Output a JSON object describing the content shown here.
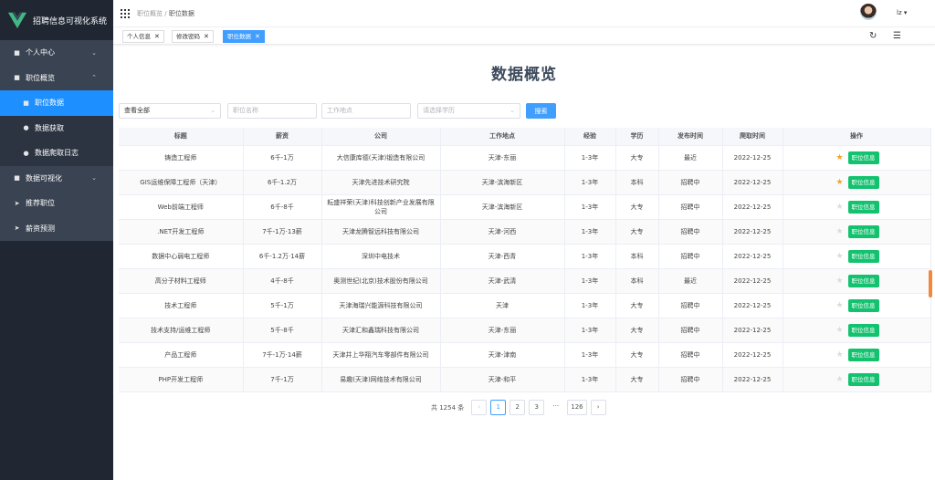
{
  "app": {
    "title": "招聘信息可视化系统"
  },
  "sidebar": {
    "items": [
      {
        "label": "个人中心",
        "icon": "square-icon"
      },
      {
        "label": "职位概览",
        "icon": "square-icon"
      },
      {
        "label": "职位数据",
        "icon": "square-icon"
      },
      {
        "label": "数据获取",
        "icon": "user-icon"
      },
      {
        "label": "数据爬取日志",
        "icon": "user-icon"
      },
      {
        "label": "数据可视化",
        "icon": "square-icon"
      },
      {
        "label": "推荐职位",
        "icon": "send-icon"
      },
      {
        "label": "薪资预测",
        "icon": "send-icon"
      }
    ]
  },
  "header": {
    "breadcrumb": [
      "职位概览",
      "职位数据"
    ],
    "user": "lz"
  },
  "tags": [
    "个人信息",
    "修改密码",
    "职位数据"
  ],
  "main": {
    "title": "数据概览",
    "filters": {
      "type": "查看全部",
      "name_placeholder": "职位名称",
      "location_placeholder": "工作地点",
      "education_placeholder": "请选择学历",
      "search_label": "搜索"
    },
    "columns": [
      "标题",
      "薪资",
      "公司",
      "工作地点",
      "经验",
      "学历",
      "发布时间",
      "爬取时间",
      "操作"
    ],
    "action_label": "职位信息",
    "rows": [
      {
        "title": "铸造工程师",
        "salary": "6千-1万",
        "company": "大信康库德(天津)锻造有限公司",
        "location": "天津-东丽",
        "exp": "1-3年",
        "edu": "大专",
        "posted": "最近",
        "crawled": "2022-12-25",
        "starred": true
      },
      {
        "title": "GIS运维保障工程师（天津）",
        "salary": "6千-1.2万",
        "company": "天津先进技术研究院",
        "location": "天津-滨海新区",
        "exp": "1-3年",
        "edu": "本科",
        "posted": "招聘中",
        "crawled": "2022-12-25",
        "starred": true
      },
      {
        "title": "Web前端工程师",
        "salary": "6千-8千",
        "company": "耘盛祥荣(天津)科技创新产业发展有限公司",
        "location": "天津-滨海新区",
        "exp": "1-3年",
        "edu": "大专",
        "posted": "招聘中",
        "crawled": "2022-12-25",
        "starred": false
      },
      {
        "title": ".NET开发工程师",
        "salary": "7千-1万·13薪",
        "company": "天津龙腾智远科技有限公司",
        "location": "天津-河西",
        "exp": "1-3年",
        "edu": "大专",
        "posted": "招聘中",
        "crawled": "2022-12-25",
        "starred": false
      },
      {
        "title": "数据中心弱电工程师",
        "salary": "6千-1.2万·14薪",
        "company": "深圳中电技术",
        "location": "天津-西青",
        "exp": "1-3年",
        "edu": "本科",
        "posted": "招聘中",
        "crawled": "2022-12-25",
        "starred": false
      },
      {
        "title": "高分子材料工程师",
        "salary": "4千-8千",
        "company": "奥测世纪(北京)技术股份有限公司",
        "location": "天津-武清",
        "exp": "1-3年",
        "edu": "本科",
        "posted": "最近",
        "crawled": "2022-12-25",
        "starred": false
      },
      {
        "title": "技术工程师",
        "salary": "5千-1万",
        "company": "天津海瑞兴能源科技有限公司",
        "location": "天津",
        "exp": "1-3年",
        "edu": "大专",
        "posted": "招聘中",
        "crawled": "2022-12-25",
        "starred": false
      },
      {
        "title": "技术支持/运维工程师",
        "salary": "5千-8千",
        "company": "天津汇和鑫瑞科技有限公司",
        "location": "天津-东丽",
        "exp": "1-3年",
        "edu": "大专",
        "posted": "招聘中",
        "crawled": "2022-12-25",
        "starred": false
      },
      {
        "title": "产品工程师",
        "salary": "7千-1万·14薪",
        "company": "天津井上华翔汽车零部件有限公司",
        "location": "天津-津南",
        "exp": "1-3年",
        "edu": "大专",
        "posted": "招聘中",
        "crawled": "2022-12-25",
        "starred": false
      },
      {
        "title": "PHP开发工程师",
        "salary": "7千-1万",
        "company": "易趣(天津)网络技术有限公司",
        "location": "天津-和平",
        "exp": "1-3年",
        "edu": "大专",
        "posted": "招聘中",
        "crawled": "2022-12-25",
        "starred": false
      }
    ],
    "pagination": {
      "total": "共 1254 条",
      "pages": [
        "1",
        "2",
        "3",
        "···",
        "126"
      ],
      "prev": "‹",
      "next": "›"
    }
  },
  "colors": {
    "sidebar": "#202733",
    "submenu": "#2c3442",
    "accent": "#409eff",
    "action": "#13c26f",
    "star": "#f2a42a"
  }
}
